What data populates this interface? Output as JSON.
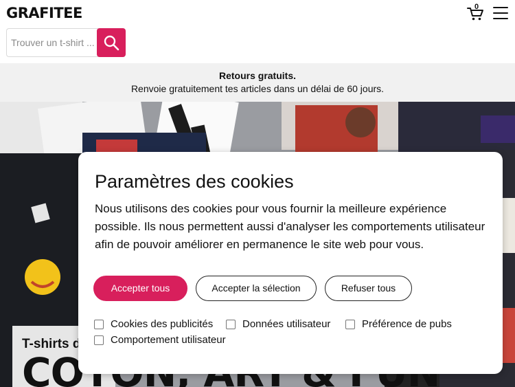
{
  "header": {
    "logo": "GRAFITEE",
    "cart_count": "0",
    "search_placeholder": "Trouver un t-shirt ..."
  },
  "banner": {
    "title": "Retours gratuits.",
    "text": "Renvoie gratuitement tes articles dans un délai de 60 jours."
  },
  "hero": {
    "subtitle": "T-shirts d",
    "headline": "COTON, ART & FUN"
  },
  "cookie_modal": {
    "title": "Paramètres des cookies",
    "text": "Nous utilisons des cookies pour vous fournir la meilleure expérience possible. Ils nous permettent aussi d'analyser les comportements utilisateur afin de pouvoir améliorer en permanence le site web pour vous.",
    "buttons": {
      "accept_all": "Accepter tous",
      "accept_selection": "Accepter la sélection",
      "refuse_all": "Refuser tous"
    },
    "options": [
      "Cookies des publicités",
      "Données utilisateur",
      "Préférence de pubs",
      "Comportement utilisateur"
    ]
  },
  "colors": {
    "accent": "#d81f5c",
    "banner_bg": "#f1f1f1"
  },
  "icons": [
    "cart-icon",
    "menu-icon",
    "search-icon"
  ]
}
